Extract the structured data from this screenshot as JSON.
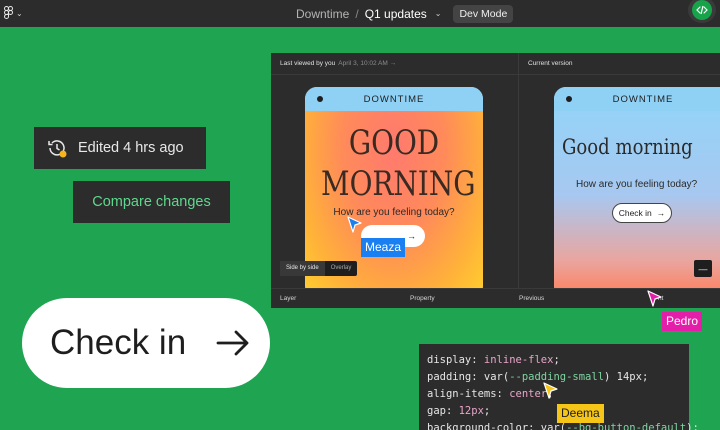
{
  "topbar": {
    "project": "Downtime",
    "separator": "/",
    "file": "Q1 updates",
    "dev_mode_label": "Dev Mode"
  },
  "edited_chip": {
    "text": "Edited 4 hrs ago"
  },
  "compare_chip": {
    "text": "Compare changes"
  },
  "big_button": {
    "label": "Check in"
  },
  "panel": {
    "left_header": "Last viewed by you",
    "left_header_meta": "April 3, 10:02 AM →",
    "right_header": "Current version",
    "phone_title": "DOWNTIME",
    "left_phone": {
      "headline_line1": "GOOD",
      "headline_line2": "MORNING",
      "subtitle": "How are you feeling today?",
      "button_label": "→"
    },
    "right_phone": {
      "headline": "Good morning",
      "subtitle": "How are you feeling today?",
      "button_label": "Check in",
      "button_arrow": "→"
    },
    "toggle": {
      "side_by_side": "Side by side",
      "overlay": "Overlay"
    },
    "minus_label": "—",
    "footer": {
      "layer": "Layer",
      "property": "Property",
      "previous": "Previous",
      "current": "nt"
    }
  },
  "code": {
    "lines": [
      {
        "prop": "display: ",
        "value": "inline-flex",
        "end": ";"
      },
      {
        "prop": "padding: var(",
        "value": "--padding-small",
        "end": ") 14px;"
      },
      {
        "prop": "align-items: ",
        "value": "center",
        "end": ";"
      },
      {
        "prop": "gap: ",
        "value": "12px",
        "end": ";"
      },
      {
        "prop": "background-color: var(",
        "value": "--bg-button-default",
        "end": ");"
      }
    ]
  },
  "cursors": {
    "meaza": {
      "name": "Meaza",
      "color": "#1a7ff0"
    },
    "pedro": {
      "name": "Pedro",
      "color": "#e41ea8"
    },
    "deema": {
      "name": "Deema",
      "color": "#f5c518"
    }
  },
  "colors": {
    "background": "#1fa552",
    "dark_surface": "#2c2c2c",
    "accent_green": "#5fd88d"
  }
}
